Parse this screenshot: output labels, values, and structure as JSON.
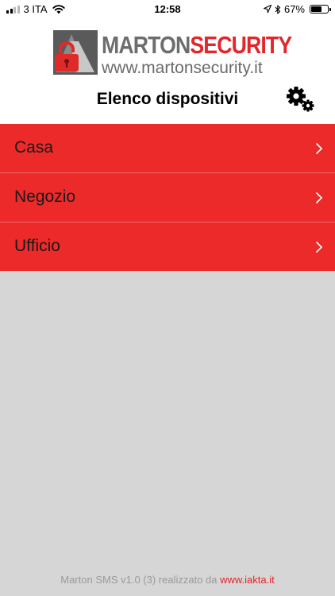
{
  "status_bar": {
    "carrier": "3 ITA",
    "time": "12:58",
    "battery_percent": "67%",
    "battery_level": 0.67,
    "signal_bars": 2,
    "icons": [
      "signal-icon",
      "wifi-icon",
      "location-arrow-icon",
      "bluetooth-icon",
      "battery-icon"
    ]
  },
  "header": {
    "brand_marton": "MARTON",
    "brand_security": "SECURITY",
    "brand_url": "www.martonsecurity.it",
    "title": "Elenco dispositivi",
    "settings_icon": "gears-icon"
  },
  "devices": [
    {
      "label": "Casa"
    },
    {
      "label": "Negozio"
    },
    {
      "label": "Ufficio"
    }
  ],
  "footer": {
    "credit": "Marton SMS  v1.0 (3) realizzato da ",
    "link": "www.iakta.it"
  },
  "colors": {
    "accent_red": "#ec2a2a",
    "brand_red": "#e3262b",
    "background": "#d6d6d6",
    "header_background": "#ffffff"
  }
}
